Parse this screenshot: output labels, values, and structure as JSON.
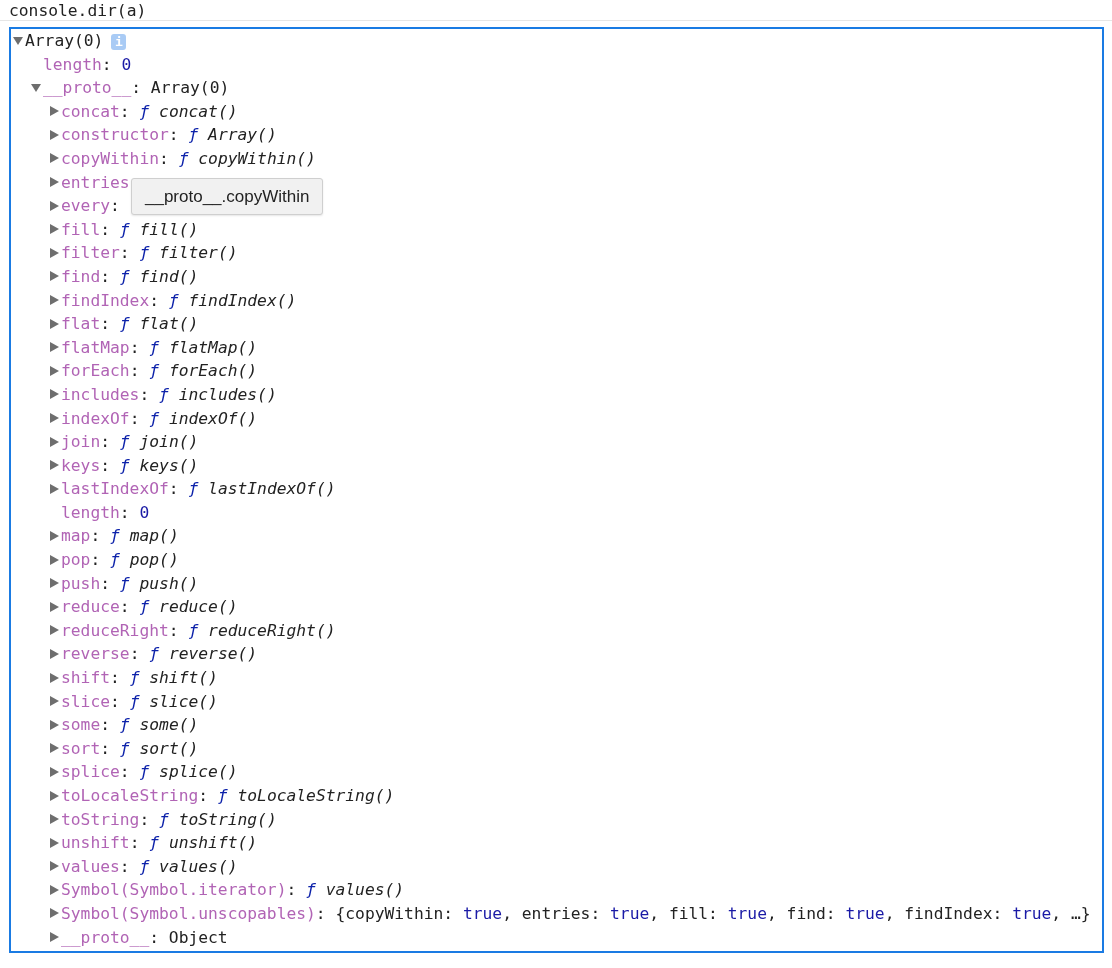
{
  "command": "console.dir(a)",
  "tree": {
    "label": "Array(0)",
    "badge": "i",
    "expandable": true,
    "expanded": true,
    "children": [
      {
        "kind": "number",
        "key": "length",
        "separator": ":",
        "value": "0",
        "expandable": false
      },
      {
        "kind": "object",
        "key": "__proto__",
        "separator": ":",
        "value": "Array(0)",
        "expandable": true,
        "expanded": true,
        "children": [
          {
            "kind": "function",
            "key": "concat",
            "separator": ":",
            "mark": "ƒ",
            "value": "concat()",
            "expandable": true,
            "expanded": false
          },
          {
            "kind": "function",
            "key": "constructor",
            "separator": ":",
            "mark": "ƒ",
            "value": "Array()",
            "expandable": true,
            "expanded": false
          },
          {
            "kind": "function",
            "key": "copyWithin",
            "separator": ":",
            "mark": "ƒ",
            "value": "copyWithin()",
            "expandable": true,
            "expanded": false
          },
          {
            "kind": "covered",
            "key": "entries",
            "expandable": true,
            "expanded": false
          },
          {
            "kind": "covered",
            "key": "every",
            "separator": ":",
            "expandable": true,
            "expanded": false
          },
          {
            "kind": "function",
            "key": "fill",
            "separator": ":",
            "mark": "ƒ",
            "value": "fill()",
            "expandable": true,
            "expanded": false
          },
          {
            "kind": "function",
            "key": "filter",
            "separator": ":",
            "mark": "ƒ",
            "value": "filter()",
            "expandable": true,
            "expanded": false
          },
          {
            "kind": "function",
            "key": "find",
            "separator": ":",
            "mark": "ƒ",
            "value": "find()",
            "expandable": true,
            "expanded": false
          },
          {
            "kind": "function",
            "key": "findIndex",
            "separator": ":",
            "mark": "ƒ",
            "value": "findIndex()",
            "expandable": true,
            "expanded": false
          },
          {
            "kind": "function",
            "key": "flat",
            "separator": ":",
            "mark": "ƒ",
            "value": "flat()",
            "expandable": true,
            "expanded": false
          },
          {
            "kind": "function",
            "key": "flatMap",
            "separator": ":",
            "mark": "ƒ",
            "value": "flatMap()",
            "expandable": true,
            "expanded": false
          },
          {
            "kind": "function",
            "key": "forEach",
            "separator": ":",
            "mark": "ƒ",
            "value": "forEach()",
            "expandable": true,
            "expanded": false
          },
          {
            "kind": "function",
            "key": "includes",
            "separator": ":",
            "mark": "ƒ",
            "value": "includes()",
            "expandable": true,
            "expanded": false
          },
          {
            "kind": "function",
            "key": "indexOf",
            "separator": ":",
            "mark": "ƒ",
            "value": "indexOf()",
            "expandable": true,
            "expanded": false
          },
          {
            "kind": "function",
            "key": "join",
            "separator": ":",
            "mark": "ƒ",
            "value": "join()",
            "expandable": true,
            "expanded": false
          },
          {
            "kind": "function",
            "key": "keys",
            "separator": ":",
            "mark": "ƒ",
            "value": "keys()",
            "expandable": true,
            "expanded": false
          },
          {
            "kind": "function",
            "key": "lastIndexOf",
            "separator": ":",
            "mark": "ƒ",
            "value": "lastIndexOf()",
            "expandable": true,
            "expanded": false
          },
          {
            "kind": "number",
            "key": "length",
            "separator": ":",
            "value": "0",
            "expandable": false
          },
          {
            "kind": "function",
            "key": "map",
            "separator": ":",
            "mark": "ƒ",
            "value": "map()",
            "expandable": true,
            "expanded": false
          },
          {
            "kind": "function",
            "key": "pop",
            "separator": ":",
            "mark": "ƒ",
            "value": "pop()",
            "expandable": true,
            "expanded": false
          },
          {
            "kind": "function",
            "key": "push",
            "separator": ":",
            "mark": "ƒ",
            "value": "push()",
            "expandable": true,
            "expanded": false
          },
          {
            "kind": "function",
            "key": "reduce",
            "separator": ":",
            "mark": "ƒ",
            "value": "reduce()",
            "expandable": true,
            "expanded": false
          },
          {
            "kind": "function",
            "key": "reduceRight",
            "separator": ":",
            "mark": "ƒ",
            "value": "reduceRight()",
            "expandable": true,
            "expanded": false
          },
          {
            "kind": "function",
            "key": "reverse",
            "separator": ":",
            "mark": "ƒ",
            "value": "reverse()",
            "expandable": true,
            "expanded": false
          },
          {
            "kind": "function",
            "key": "shift",
            "separator": ":",
            "mark": "ƒ",
            "value": "shift()",
            "expandable": true,
            "expanded": false
          },
          {
            "kind": "function",
            "key": "slice",
            "separator": ":",
            "mark": "ƒ",
            "value": "slice()",
            "expandable": true,
            "expanded": false
          },
          {
            "kind": "function",
            "key": "some",
            "separator": ":",
            "mark": "ƒ",
            "value": "some()",
            "expandable": true,
            "expanded": false
          },
          {
            "kind": "function",
            "key": "sort",
            "separator": ":",
            "mark": "ƒ",
            "value": "sort()",
            "expandable": true,
            "expanded": false
          },
          {
            "kind": "function",
            "key": "splice",
            "separator": ":",
            "mark": "ƒ",
            "value": "splice()",
            "expandable": true,
            "expanded": false
          },
          {
            "kind": "function",
            "key": "toLocaleString",
            "separator": ":",
            "mark": "ƒ",
            "value": "toLocaleString()",
            "expandable": true,
            "expanded": false
          },
          {
            "kind": "function",
            "key": "toString",
            "separator": ":",
            "mark": "ƒ",
            "value": "toString()",
            "expandable": true,
            "expanded": false
          },
          {
            "kind": "function",
            "key": "unshift",
            "separator": ":",
            "mark": "ƒ",
            "value": "unshift()",
            "expandable": true,
            "expanded": false
          },
          {
            "kind": "function",
            "key": "values",
            "separator": ":",
            "mark": "ƒ",
            "value": "values()",
            "expandable": true,
            "expanded": false
          },
          {
            "kind": "function",
            "key": "Symbol(Symbol.iterator)",
            "separator": ":",
            "mark": "ƒ",
            "value": "values()",
            "expandable": true,
            "expanded": false
          },
          {
            "kind": "summary",
            "key": "Symbol(Symbol.unscopables)",
            "separator": ":",
            "open": "{",
            "items": [
              {
                "key": "copyWithin",
                "separator": ":",
                "value": "true",
                "trailer": ","
              },
              {
                "key": "entries",
                "separator": ":",
                "value": "true",
                "trailer": ","
              },
              {
                "key": "fill",
                "separator": ":",
                "value": "true",
                "trailer": ","
              },
              {
                "key": "find",
                "separator": ":",
                "value": "true",
                "trailer": ","
              },
              {
                "key": "findIndex",
                "separator": ":",
                "value": "true",
                "trailer": ","
              }
            ],
            "close": "…}",
            "expandable": true,
            "expanded": false
          },
          {
            "kind": "object",
            "key": "__proto__",
            "separator": ":",
            "value": "Object",
            "expandable": true,
            "expanded": false
          }
        ]
      }
    ]
  },
  "tooltip": "__proto__.copyWithin"
}
